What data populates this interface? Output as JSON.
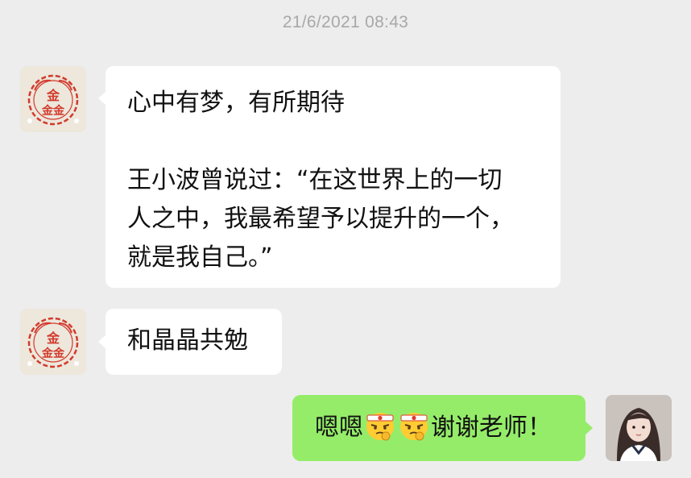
{
  "chat": {
    "timestamp": "21/6/2021 08:43",
    "messages": [
      {
        "sender": "teacher",
        "paragraphs": [
          [
            "心中有梦，有所期待"
          ],
          [
            "王小波曾说过：“在这世界上的一切",
            "人之中，我最希望予以提升的一个，",
            "就是我自己。”"
          ]
        ]
      },
      {
        "sender": "teacher",
        "text": "和晶晶共勉"
      },
      {
        "sender": "me",
        "text_before": "嗯嗯",
        "text_after": "谢谢老师！",
        "emoji_count": 2
      }
    ],
    "avatars": {
      "teacher": {
        "icon": "red-seal-avatar-icon",
        "seal_text": "金鑫"
      },
      "me": {
        "icon": "girl-photo-avatar-icon"
      }
    },
    "emoji": {
      "icon": "determined-face-headband-emoji-icon"
    },
    "colors": {
      "background": "#ededed",
      "incoming_bubble": "#ffffff",
      "outgoing_bubble": "#95ec69",
      "timestamp": "#a8a8a8",
      "seal_red": "#d23a2c"
    }
  }
}
